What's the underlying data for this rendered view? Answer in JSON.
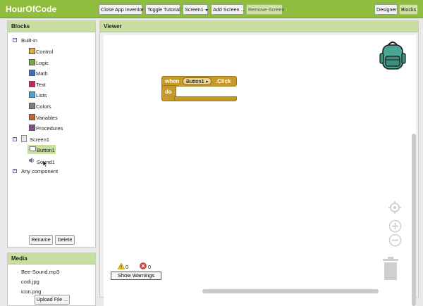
{
  "app": {
    "title": "HourOfCode"
  },
  "toolbar": {
    "close_app_inventor": "Close App Inventor",
    "toggle_tutorial": "Toggle Tutorial",
    "screen_select": "Screen1",
    "add_screen": "Add Screen ...",
    "remove_screen": "Remove Screen",
    "designer": "Designer",
    "blocks": "Blocks"
  },
  "blocks_panel": {
    "title": "Blocks",
    "builtin_label": "Built-in",
    "builtin_items": [
      {
        "label": "Control",
        "color": "#e1a93a"
      },
      {
        "label": "Logic",
        "color": "#77ab41"
      },
      {
        "label": "Math",
        "color": "#3f71b5"
      },
      {
        "label": "Text",
        "color": "#b32d5e"
      },
      {
        "label": "Lists",
        "color": "#49a6d4"
      },
      {
        "label": "Colors",
        "color": "#7d7d7d"
      },
      {
        "label": "Variables",
        "color": "#d05f2d"
      },
      {
        "label": "Procedures",
        "color": "#7c5385"
      }
    ],
    "screen_label": "Screen1",
    "components": [
      {
        "label": "Button1"
      },
      {
        "label": "Sound1"
      }
    ],
    "any_component": "Any component",
    "rename": "Rename",
    "delete": "Delete"
  },
  "media_panel": {
    "title": "Media",
    "files": [
      "Bee-Sound.mp3",
      "codi.jpg",
      "icon.png"
    ],
    "upload": "Upload File ..."
  },
  "viewer": {
    "title": "Viewer",
    "block": {
      "when": "when",
      "component": "Button1",
      "event": ".Click",
      "do": "do"
    },
    "warnings_count": "0",
    "errors_count": "0",
    "show_warnings": "Show Warnings"
  }
}
